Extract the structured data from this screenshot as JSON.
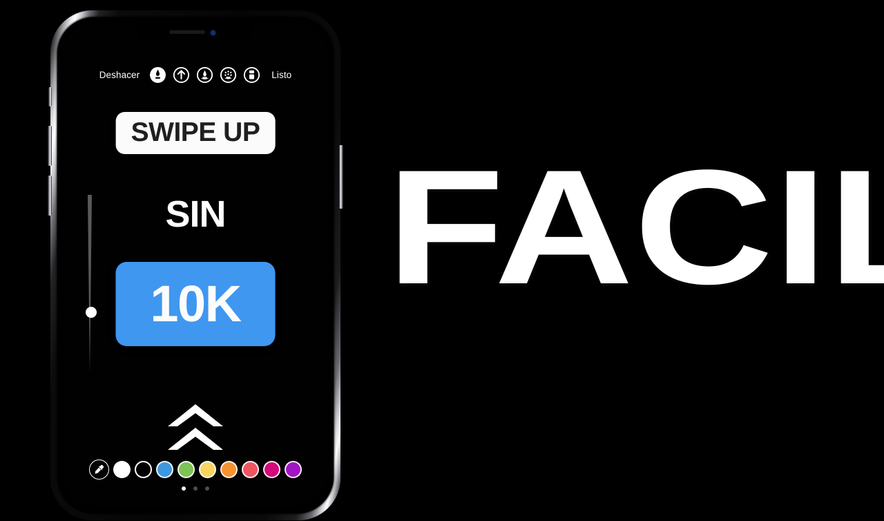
{
  "background_color": "#000000",
  "headline": {
    "text": "FACIL",
    "color": "#ffffff"
  },
  "phone": {
    "device": "iphone-x",
    "frame_color": "#c9c9ce",
    "screen_background": "#010101",
    "notch": {
      "speaker_label": "earpiece-speaker",
      "camera_label": "front-camera"
    },
    "side_buttons": {
      "silent_switch": "silent-switch",
      "volume_up": "volume-up-button",
      "volume_down": "volume-down-button",
      "power": "power-button"
    }
  },
  "screen": {
    "app": "instagram-story-draw",
    "toolbar": {
      "undo_label": "Deshacer",
      "done_label": "Listo",
      "tools": [
        {
          "id": "pen",
          "name": "pen-tool-icon",
          "active": true
        },
        {
          "id": "arrow",
          "name": "arrow-up-tool-icon",
          "active": false
        },
        {
          "id": "highlighter",
          "name": "highlighter-tool-icon",
          "active": false
        },
        {
          "id": "spray",
          "name": "spray-tool-icon",
          "active": false
        },
        {
          "id": "eraser",
          "name": "eraser-tool-icon",
          "active": false
        }
      ]
    },
    "brush_size": {
      "label": "brush-size-slider",
      "value_percent": 38
    },
    "stickers": {
      "swipe_up_text": "SWIPE UP",
      "swipe_up_bg": "#fbfbfb",
      "swipe_up_text_color": "#1f1f1f",
      "sin_text": "SIN",
      "sin_color": "#ffffff",
      "count_text": "10K",
      "count_bg": "#3f97f0",
      "count_text_color": "#fcfcfc",
      "chevron_label": "double-chevron-up-icon"
    },
    "palette": {
      "eyedropper_label": "eyedropper-icon",
      "selected_index": 1,
      "swatches": [
        {
          "name": "swatch-white",
          "color": "#ffffff",
          "style": "solid"
        },
        {
          "name": "swatch-black",
          "color": "#000000",
          "style": "outline"
        },
        {
          "name": "swatch-blue",
          "color": "#3d98e0",
          "style": "ring"
        },
        {
          "name": "swatch-green",
          "color": "#7dc356",
          "style": "ring"
        },
        {
          "name": "swatch-yellow",
          "color": "#f8d45f",
          "style": "ring"
        },
        {
          "name": "swatch-orange",
          "color": "#f69330",
          "style": "ring"
        },
        {
          "name": "swatch-red",
          "color": "#ef5560",
          "style": "ring"
        },
        {
          "name": "swatch-magenta",
          "color": "#d6087a",
          "style": "ring"
        },
        {
          "name": "swatch-purple",
          "color": "#a315c4",
          "style": "ring"
        }
      ],
      "page_dots": {
        "count": 3,
        "active_index": 0
      }
    }
  }
}
